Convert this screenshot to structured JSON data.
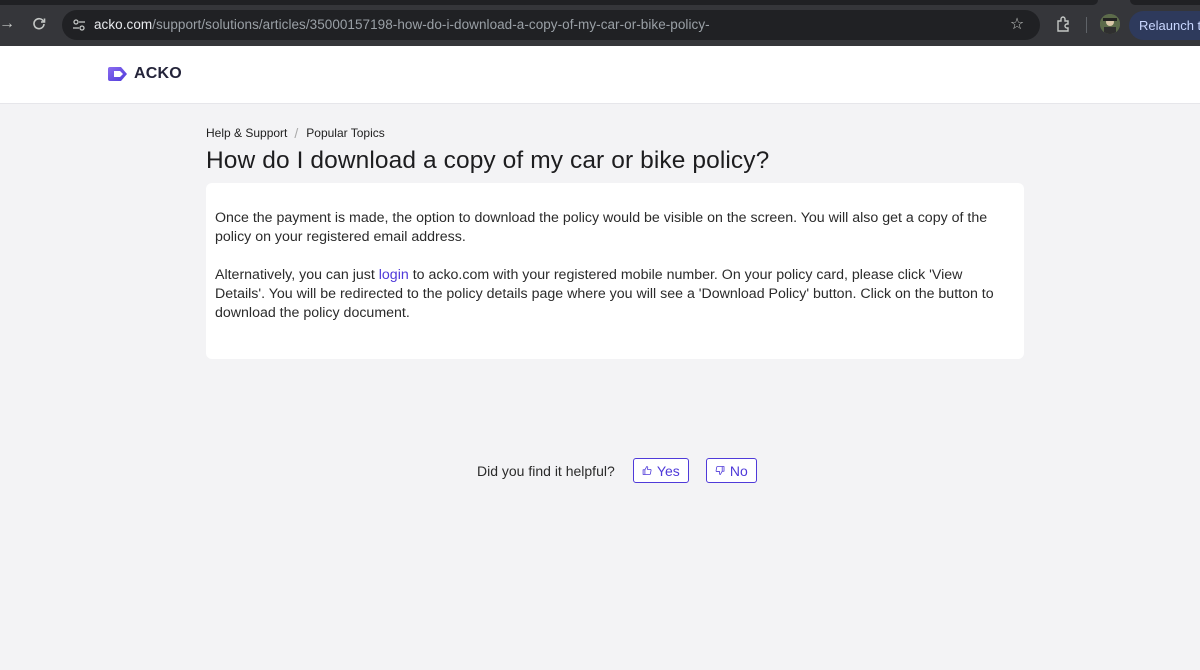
{
  "browser": {
    "url_host": "acko.com",
    "url_path": "/support/solutions/articles/35000157198-how-do-i-download-a-copy-of-my-car-or-bike-policy-",
    "relaunch_label": "Relaunch to"
  },
  "site": {
    "logo_text": "ACKO",
    "brand_color": "#4f3ad9"
  },
  "breadcrumb": {
    "items": [
      "Help & Support",
      "Popular Topics"
    ],
    "separator": "/"
  },
  "article": {
    "title": "How do I download a copy of my car or bike policy?",
    "para1": "Once the payment is made, the option to download the policy would be visible on the screen. You will also get a copy of the policy on your registered email address.",
    "para2_before": "Alternatively, you can just ",
    "para2_link": "login",
    "para2_after": " to acko.com with your registered mobile number. On your policy card, please click 'View Details'. You will be redirected to the policy details page where you will see a 'Download Policy' button. Click on the button to download the policy document."
  },
  "feedback": {
    "question": "Did you find it helpful?",
    "yes_label": "Yes",
    "no_label": "No"
  }
}
